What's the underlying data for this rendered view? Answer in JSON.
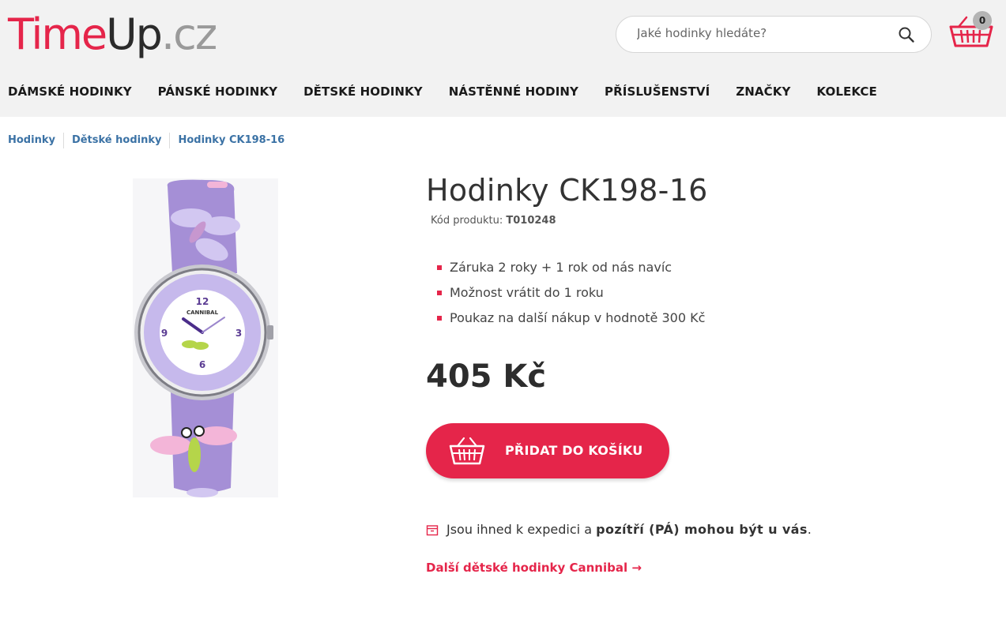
{
  "logo": {
    "part1": "Time",
    "part2": "Up",
    "part3": ".cz"
  },
  "search": {
    "placeholder": "Jaké hodinky hledáte?",
    "icon": "search-icon"
  },
  "cart": {
    "count": "0",
    "icon": "basket-icon"
  },
  "nav": {
    "items": [
      "DÁMSKÉ HODINKY",
      "PÁNSKÉ HODINKY",
      "DĚTSKÉ HODINKY",
      "NÁSTĚNNÉ HODINY",
      "PŘÍSLUŠENSTVÍ",
      "ZNAČKY",
      "KOLEKCE"
    ]
  },
  "breadcrumb": [
    "Hodinky",
    "Dětské hodinky",
    "Hodinky CK198-16"
  ],
  "product": {
    "title": "Hodinky CK198-16",
    "code_label": "Kód produktu:",
    "code_value": "T010248",
    "image_brand": "CANNIBAL",
    "benefits": [
      "Záruka 2 roky + 1 rok od nás navíc",
      "Možnost vrátit do 1 roku",
      "Poukaz na další nákup v hodnotě 300 Kč"
    ],
    "price": "405 Kč",
    "add_to_cart": "PŘIDAT DO KOŠÍKU",
    "shipping_prefix": "Jsou ihned k expedici a",
    "shipping_bold": "pozítří (PÁ) mohou být u vás",
    "shipping_suffix": ".",
    "more_link": "Další dětské hodinky Cannibal →"
  },
  "colors": {
    "accent": "#e5254a",
    "link": "#3b72a5",
    "header_bg": "#f2f2f2"
  }
}
